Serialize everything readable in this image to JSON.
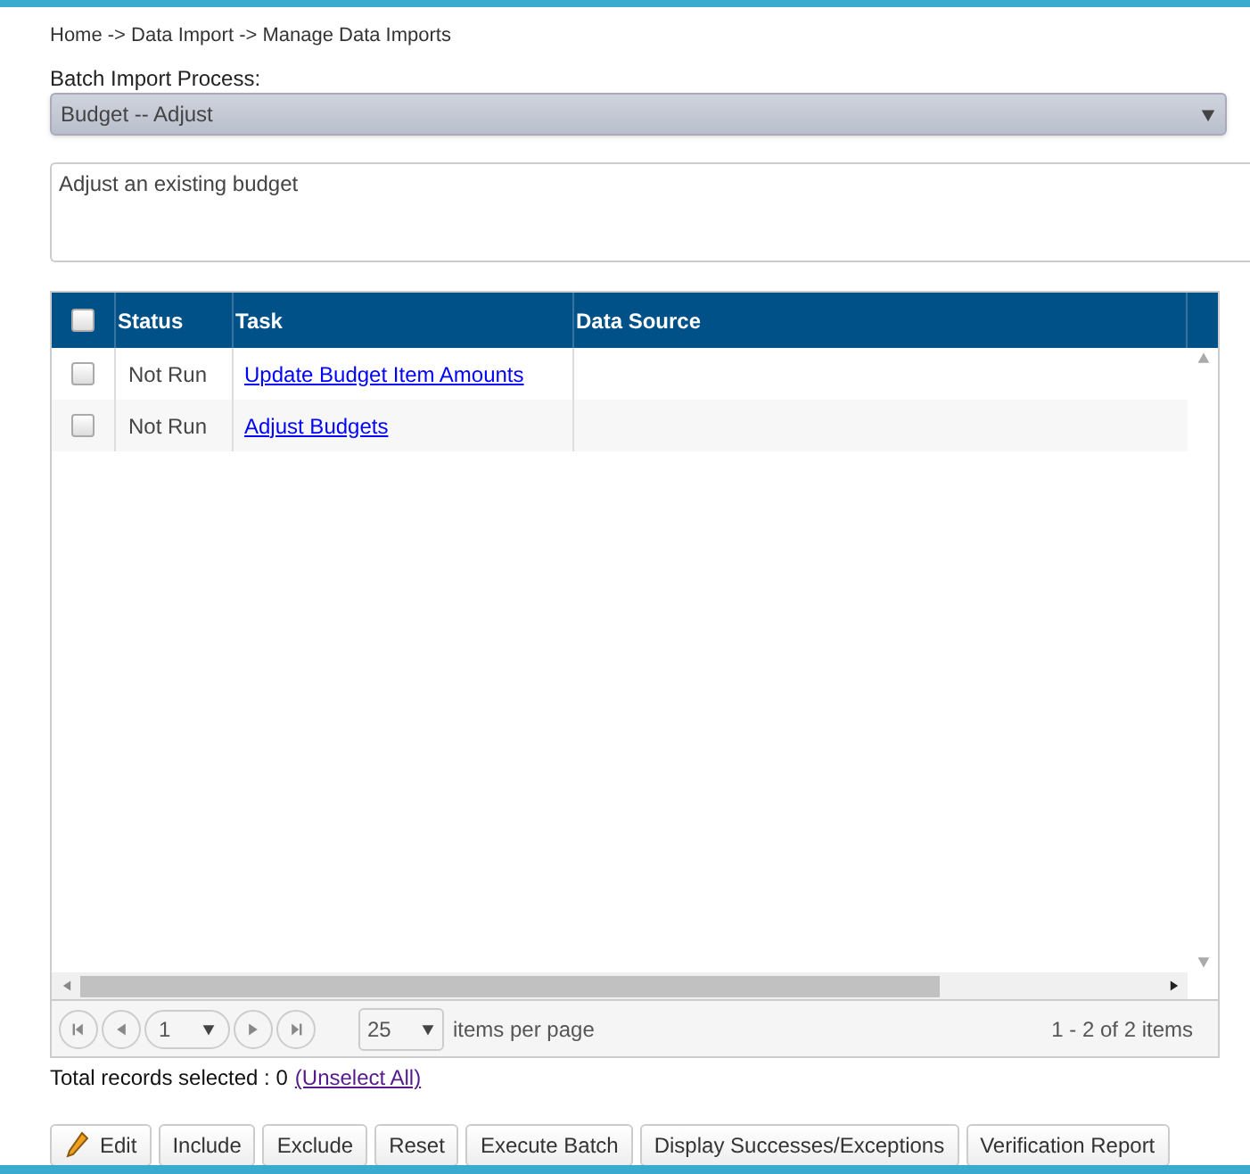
{
  "breadcrumb": "Home -> Data Import -> Manage Data Imports",
  "process": {
    "label": "Batch Import Process:",
    "value": "Budget -- Adjust"
  },
  "description": "Adjust an existing budget",
  "table": {
    "header_checked": false,
    "columns": [
      "Status",
      "Task",
      "Data Source"
    ],
    "rows": [
      {
        "checked": false,
        "status": "Not Run",
        "task": "Update Budget Item Amounts",
        "data_source": ""
      },
      {
        "checked": false,
        "status": "Not Run",
        "task": "Adjust Budgets",
        "data_source": ""
      }
    ]
  },
  "pager": {
    "page": "1",
    "page_size": "25",
    "page_size_label": "items per page",
    "summary": "1 - 2 of 2 items"
  },
  "selection": {
    "text": "Total records selected : 0",
    "link": "(Unselect All)"
  },
  "buttons": [
    {
      "kind": "edit",
      "label": "Edit"
    },
    {
      "kind": "plain",
      "label": "Include"
    },
    {
      "kind": "plain",
      "label": "Exclude"
    },
    {
      "kind": "plain",
      "label": "Reset"
    },
    {
      "kind": "plain",
      "label": "Execute Batch"
    },
    {
      "kind": "plain",
      "label": "Display Successes/Exceptions"
    },
    {
      "kind": "plain",
      "label": "Verification Report"
    }
  ]
}
